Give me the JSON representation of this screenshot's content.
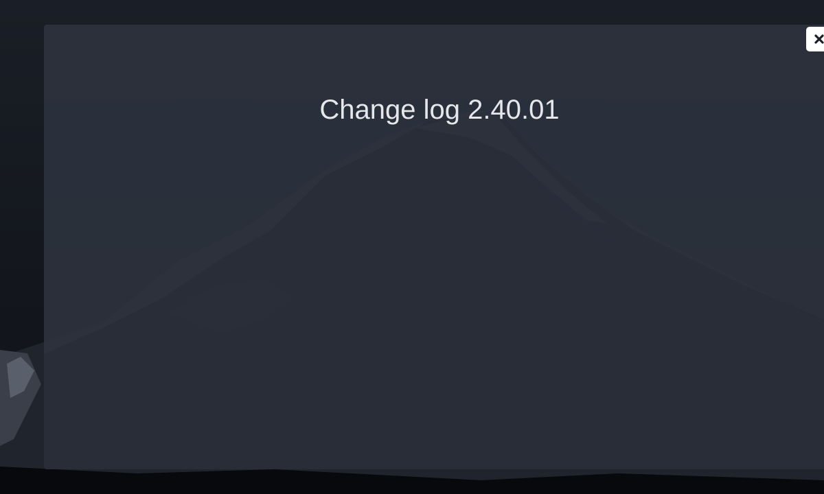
{
  "modal": {
    "title": "Change log 2.40.01"
  },
  "close_button": {
    "icon": "close-icon"
  }
}
